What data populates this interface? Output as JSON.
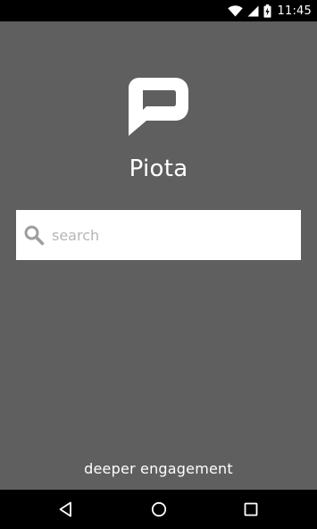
{
  "status_bar": {
    "time": "11:45",
    "icons": [
      "wifi-icon",
      "cell-signal-icon",
      "battery-charging-icon"
    ]
  },
  "app": {
    "title": "Piota",
    "logo_icon": "piota-speech-bubble-logo",
    "tagline": "deeper engagement"
  },
  "search": {
    "placeholder": "search",
    "value": "",
    "icon": "search-icon"
  },
  "nav_bar": {
    "icons": [
      "back-icon",
      "home-icon",
      "recents-icon"
    ]
  },
  "colors": {
    "background": "#5f5f5f",
    "bars": "#000000",
    "text": "#ffffff",
    "search_box": "#ffffff",
    "placeholder": "#b6b6b6",
    "search_icon": "#9e9e9e"
  }
}
